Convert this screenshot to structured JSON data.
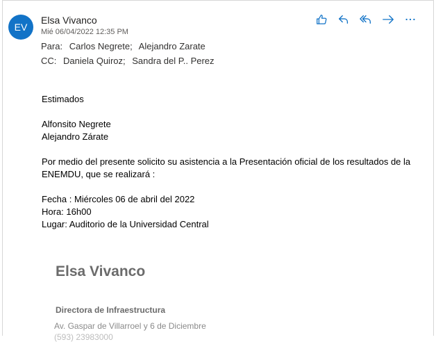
{
  "message": {
    "sender_initials": "EV",
    "sender_name": "Elsa Vivanco",
    "date": "Mié 06/04/2022 12:35 PM",
    "to_label": "Para:",
    "to": [
      "Carlos Negrete;",
      "Alejandro Zarate"
    ],
    "cc_label": "CC:",
    "cc": [
      "Daniela Quiroz;",
      "Sandra del P.. Perez"
    ]
  },
  "actions": [
    {
      "icon": "like-icon"
    },
    {
      "icon": "reply-icon"
    },
    {
      "icon": "reply-all-icon"
    },
    {
      "icon": "forward-icon"
    },
    {
      "icon": "more-icon"
    }
  ],
  "body": {
    "greeting": "Estimados",
    "names": [
      "Alfonsito Negrete",
      "Alejandro Zárate"
    ],
    "paragraph": "Por medio del presente solicito su asistencia a la Presentación oficial de los resultados de la ENEMDU, que se realizará :",
    "fecha": "Fecha : Miércoles 06 de abril del 2022",
    "hora": "Hora: 16h00",
    "lugar": "Lugar: Auditorio de la Universidad Central"
  },
  "signature": {
    "name": "Elsa Vivanco",
    "title": "Directora de Infraestructura",
    "address": "Av. Gaspar de Villarroel y 6 de Diciembre",
    "partial": "(593) 23983000"
  },
  "colors": {
    "accent": "#1273c7",
    "avatar_bg": "#1273c7",
    "signature_gray": "#6b6b6b"
  }
}
